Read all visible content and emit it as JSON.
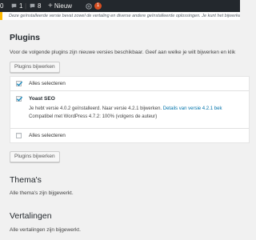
{
  "adminbar": {
    "counter_value": "0",
    "comments_count": "1",
    "updates_count": "8",
    "new_label": "Nieuw",
    "profile_badge": "1"
  },
  "notice": {
    "text": "Deze geïnstalleerde versie bevat zowel de vertaling en diverse andere geïnstalleerde oplossingen. Je kunt het bijwerken van de versie"
  },
  "plugins": {
    "heading": "Plugins",
    "description": "Voor de volgende plugins zijn nieuwe versies beschikbaar. Geef aan welke je wilt bijwerken en klik",
    "update_button": "Plugins bijwerken",
    "select_all_label": "Alles selecteren",
    "items": [
      {
        "name": "Yoast SEO",
        "line1_prefix": "Je hebt versie 4.0.2 geïnstalleerd. Naar versie 4.2.1 bijwerken. ",
        "line1_link": "Details van versie 4.2.1 bek",
        "line2": "Compatibel met WordPress 4.7.2: 100% (volgens de auteur)"
      }
    ]
  },
  "themes": {
    "heading": "Thema's",
    "description": "Alle thema's zijn bijgewerkt."
  },
  "translations": {
    "heading": "Vertalingen",
    "description": "Alle vertalingen zijn bijgewerkt."
  },
  "colors": {
    "adminbar_bg": "#23282d",
    "link": "#0073aa",
    "badge": "#d54e21",
    "notice_border": "#ffb900"
  }
}
